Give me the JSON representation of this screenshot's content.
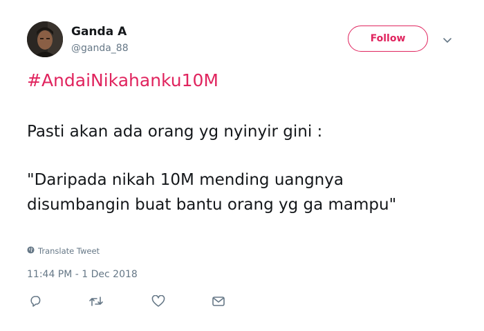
{
  "user": {
    "name": "Ganda A",
    "handle": "@ganda_88"
  },
  "follow_label": "Follow",
  "tweet": {
    "hashtag": "#AndaiNikahanku10M",
    "line1": "Pasti akan ada orang yg nyinyir gini :",
    "quote": "\"Daripada nikah 10M mending uangnya disumbangin buat bantu orang yg ga mampu\""
  },
  "translate_label": "Translate Tweet",
  "timestamp": "11:44 PM - 1 Dec 2018",
  "colors": {
    "accent": "#e0245e",
    "secondary_text": "#657786",
    "icon": "#657786"
  },
  "icons": {
    "actions": [
      "reply-icon",
      "retweet-icon",
      "like-icon",
      "direct-message-icon"
    ],
    "menu": "chevron-down-icon",
    "translate": "globe-icon"
  }
}
